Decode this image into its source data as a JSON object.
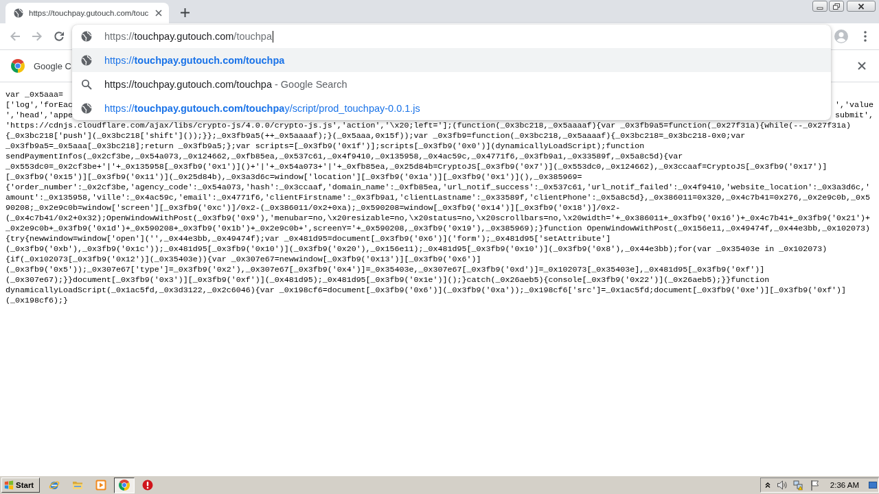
{
  "window": {
    "tabs": [
      {
        "title": "https://touchpay.gutouch.com/touc",
        "selected": true
      }
    ]
  },
  "toolbar": {
    "nav": [
      {
        "kind": "back",
        "disabled": true
      },
      {
        "kind": "forward",
        "disabled": true
      },
      {
        "kind": "reload",
        "disabled": false
      }
    ]
  },
  "omnibox": {
    "scheme": "https://",
    "host": "touchpay.gutouch.com",
    "path": "/touchpa",
    "suggestions": [
      {
        "kind": "url",
        "text": "https://**touchpay.gutouch.com/touchpa**",
        "selected": true
      },
      {
        "kind": "search",
        "text": "https://touchpay.gutouch.com/touchpa",
        "hint": "- Google Search",
        "selected": false
      },
      {
        "kind": "url",
        "text": "https://**touchpay.gutouch.com/touchpa**y/script/prod_touchpay-0.0.1.js",
        "selected": false
      }
    ]
  },
  "infobar": {
    "text": "Google C"
  },
  "page": {
    "lines": [
      {
        "kind": "full",
        "text": "var _0x5aaa="
      },
      {
        "kind": "split",
        "start": "['log','forEac",
        "end": "','value"
      },
      {
        "kind": "split",
        "start": "','head','appe",
        "end": "submit',"
      },
      {
        "kind": "full",
        "text": "'https://cdnjs.cloudflare.com/ajax/libs/crypto-js/4.0.0/crypto-js.js','action','\\x20;left='];(function(_0x3bc218,_0x5aaaaf){var _0x3fb9a5=function(_0x27f31a){while(--_0x27f31a)"
      },
      {
        "kind": "full",
        "text": "{_0x3bc218['push'](_0x3bc218['shift']());}};_0x3fb9a5(++_0x5aaaaf);}(_0x5aaa,0x15f));var _0x3fb9=function(_0x3bc218,_0x5aaaaf){_0x3bc218=_0x3bc218-0x0;var"
      },
      {
        "kind": "full",
        "text": "_0x3fb9a5=_0x5aaa[_0x3bc218];return _0x3fb9a5;};var scripts=[_0x3fb9('0x1f')];scripts[_0x3fb9('0x0')](dynamicallyLoadScript);function"
      },
      {
        "kind": "full",
        "text": "sendPaymentInfos(_0x2cf3be,_0x54a073,_0x124662,_0xfb85ea,_0x537c61,_0x4f9410,_0x135958,_0x4ac59c,_0x4771f6,_0x3fb9a1,_0x33589f,_0x5a8c5d){var"
      },
      {
        "kind": "full",
        "text": "_0x553dc0=_0x2cf3be+'|'+_0x135958[_0x3fb9('0x1')]()+'|'+_0x54a073+'|'+_0xfb85ea,_0x25d84b=CryptoJS[_0x3fb9('0x7')](_0x553dc0,_0x124662),_0x3ccaaf=CryptoJS[_0x3fb9('0x17')]"
      },
      {
        "kind": "full",
        "text": "[_0x3fb9('0x15')][_0x3fb9('0x11')](_0x25d84b),_0x3a3d6c=window['location'][_0x3fb9('0x1a')][_0x3fb9('0x1')](),_0x385969="
      },
      {
        "kind": "full",
        "text": "{'order_number':_0x2cf3be,'agency_code':_0x54a073,'hash':_0x3ccaaf,'domain_name':_0xfb85ea,'url_notif_success':_0x537c61,'url_notif_failed':_0x4f9410,'website_location':_0x3a3d6c,'"
      },
      {
        "kind": "full",
        "text": "amount':_0x135958,'ville':_0x4ac59c,'email':_0x4771f6,'clientFirstname':_0x3fb9a1,'clientLastname':_0x33589f,'clientPhone':_0x5a8c5d},_0x386011=0x320,_0x4c7b41=0x276,_0x2e9c0b,_0x5"
      },
      {
        "kind": "full",
        "text": "90208;_0x2e9c0b=window['screen'][_0x3fb9('0xc')]/0x2-(_0x386011/0x2+0xa);_0x590208=window[_0x3fb9('0x14')][_0x3fb9('0x18')]/0x2-"
      },
      {
        "kind": "full",
        "text": "(_0x4c7b41/0x2+0x32);OpenWindowWithPost(_0x3fb9('0x9'),'menubar=no,\\x20resizable=no,\\x20status=no,\\x20scrollbars=no,\\x20width='+_0x386011+_0x3fb9('0x16')+_0x4c7b41+_0x3fb9('0x21')+"
      },
      {
        "kind": "full",
        "text": "_0x2e9c0b+_0x3fb9('0x1d')+_0x590208+_0x3fb9('0x1b')+_0x2e9c0b+',screenY='+_0x590208,_0x3fb9('0x19'),_0x385969);}function OpenWindowWithPost(_0x156e11,_0x49474f,_0x44e3bb,_0x102073)"
      },
      {
        "kind": "full",
        "text": "{try{newwindow=window['open']('',_0x44e3bb,_0x49474f);var _0x481d95=document[_0x3fb9('0x6')]('form');_0x481d95['setAttribute']"
      },
      {
        "kind": "full",
        "text": "(_0x3fb9('0xb'),_0x3fb9('0x1c'));_0x481d95[_0x3fb9('0x10')](_0x3fb9('0x20'),_0x156e11);_0x481d95[_0x3fb9('0x10')](_0x3fb9('0x8'),_0x44e3bb);for(var _0x35403e in _0x102073)"
      },
      {
        "kind": "full",
        "text": "{if(_0x102073[_0x3fb9('0x12')](_0x35403e)){var _0x307e67=newwindow[_0x3fb9('0x13')][_0x3fb9('0x6')]"
      },
      {
        "kind": "full",
        "text": "(_0x3fb9('0x5'));_0x307e67['type']=_0x3fb9('0x2'),_0x307e67[_0x3fb9('0x4')]=_0x35403e,_0x307e67[_0x3fb9('0xd')]=_0x102073[_0x35403e],_0x481d95[_0x3fb9('0xf')]"
      },
      {
        "kind": "full",
        "text": "(_0x307e67);}}document[_0x3fb9('0x3')][_0x3fb9('0xf')](_0x481d95);_0x481d95[_0x3fb9('0x1e')]();}catch(_0x26aeb5){console[_0x3fb9('0x22')](_0x26aeb5);}}function"
      },
      {
        "kind": "full",
        "text": "dynamicallyLoadScript(_0x1ac5fd,_0x3d3122,_0x2c6046){var _0x198cf6=document[_0x3fb9('0x6')](_0x3fb9('0xa'));_0x198cf6['src']=_0x1ac5fd;document[_0x3fb9('0xe')][_0x3fb9('0xf')]"
      },
      {
        "kind": "full",
        "text": "(_0x198cf6);}"
      }
    ]
  },
  "taskbar": {
    "start": "Start",
    "items": [
      {
        "kind": "ie",
        "selected": false
      },
      {
        "kind": "folder",
        "selected": false
      },
      {
        "kind": "media",
        "selected": false
      },
      {
        "kind": "chrome",
        "selected": true
      },
      {
        "kind": "alert",
        "selected": false
      }
    ],
    "clock": "2:36 AM"
  }
}
